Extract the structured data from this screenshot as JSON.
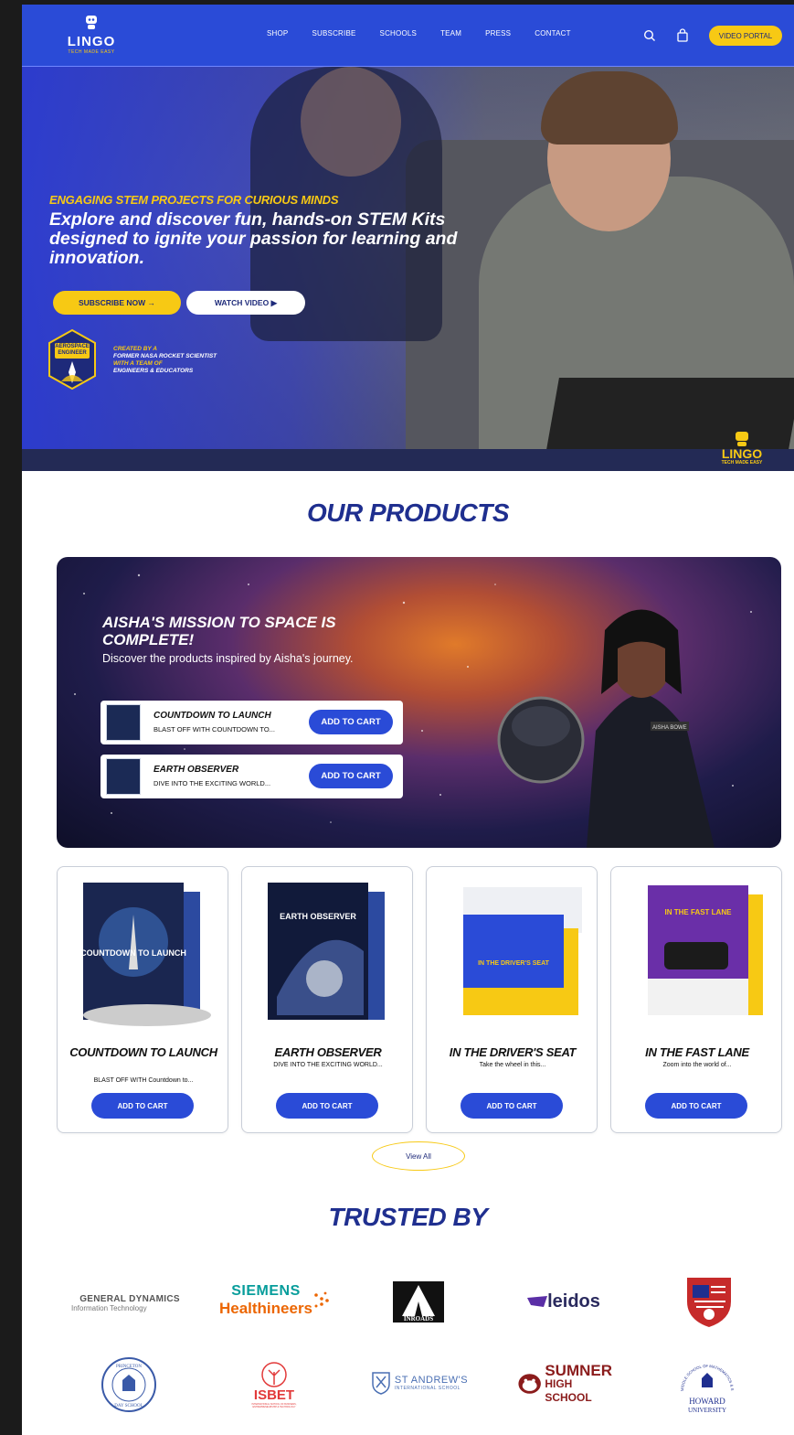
{
  "header": {
    "logo_word": "LINGO",
    "logo_tagline": "TECH MADE EASY",
    "nav": [
      "SHOP",
      "SUBSCRIBE",
      "SCHOOLS",
      "TEAM",
      "PRESS",
      "CONTACT"
    ],
    "video_portal": "VIDEO PORTAL",
    "icons": [
      "search-icon",
      "shopping-bag-icon"
    ]
  },
  "hero": {
    "kicker": "ENGAGING STEM PROJECTS FOR CURIOUS MINDS",
    "title": "Explore and discover fun, hands-on STEM Kits designed to ignite your passion for learning and innovation.",
    "subscribe_btn": "SUBSCRIBE NOW →",
    "watch_btn": "WATCH VIDEO ▶",
    "badge_line1": "AEROSPACE",
    "badge_line2": "ENGINEER",
    "badge_caption_1": "CREATED BY A",
    "badge_caption_2": "FORMER NASA ROCKET SCIENTIST",
    "badge_caption_3": "WITH A TEAM OF",
    "badge_caption_4": "ENGINEERS & EDUCATORS",
    "corner_logo": "LINGO",
    "corner_tagline": "TECH MADE EASY"
  },
  "products": {
    "title": "OUR PRODUCTS",
    "banner": {
      "title": "AISHA'S MISSION TO SPACE IS COMPLETE!",
      "subtitle": "Discover the products inspired by Aisha's journey.",
      "nametag": "AISHA BOWE",
      "items": [
        {
          "name": "COUNTDOWN TO LAUNCH",
          "desc": "BLAST OFF WITH COUNTDOWN TO...",
          "btn": "ADD TO CART"
        },
        {
          "name": "EARTH OBSERVER",
          "desc": "DIVE INTO THE EXCITING WORLD...",
          "btn": "ADD TO CART"
        }
      ]
    },
    "cards": [
      {
        "name": "COUNTDOWN TO LAUNCH",
        "desc": "BLAST OFF WITH Countdown to...",
        "btn": "ADD TO CART",
        "box_text": "COUNTDOWN TO LAUNCH"
      },
      {
        "name": "EARTH OBSERVER",
        "desc": "DIVE INTO THE EXCITING WORLD...",
        "btn": "ADD TO CART",
        "box_text": "EARTH OBSERVER"
      },
      {
        "name": "IN THE DRIVER'S SEAT",
        "desc": "Take the wheel in this...",
        "btn": "ADD TO CART",
        "box_text": "IN THE DRIVER'S SEAT"
      },
      {
        "name": "IN THE FAST LANE",
        "desc": "Zoom into the world of...",
        "btn": "ADD TO CART",
        "box_text": "IN THE FAST LANE"
      }
    ],
    "view_all": "View All"
  },
  "trusted": {
    "title": "TRUSTED BY",
    "logos": {
      "gd_1": "GENERAL DYNAMICS",
      "gd_2": "Information Technology",
      "siemens_1": "SIEMENS",
      "siemens_2": "Healthineers",
      "inroads": "INROADS",
      "leidos": "leidos",
      "princeton_1": "PRINCETON",
      "princeton_2": "DAY SCHOOL",
      "isbet": "ISBET",
      "isbet_sub": "INTERNATIONAL SCHOOL OF BUSINESS, ENTREPRENEURSHIP & TECHNOLOGY",
      "standrews_1": "ST ANDREW'S",
      "standrews_2": "INTERNATIONAL SCHOOL",
      "sumner_1": "SUMNER",
      "sumner_2": "HIGH SCHOOL",
      "howard_1": "HOWARD",
      "howard_2": "UNIVERSITY",
      "howard_arc": "MIDDLE SCHOOL OF MATHEMATICS & SCIENCE"
    }
  },
  "colors": {
    "brand_blue": "#2a4bd7",
    "brand_yellow": "#f7c914",
    "title_navy": "#1f2f8f"
  }
}
